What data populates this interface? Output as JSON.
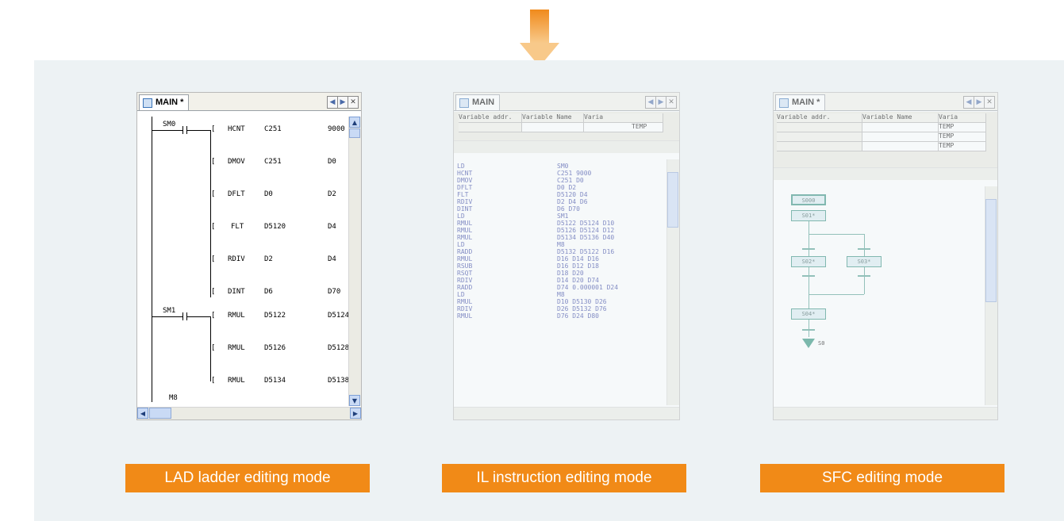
{
  "colors": {
    "accent": "#f18a17",
    "panel": "#edf2f4"
  },
  "captions": {
    "lad": "LAD ladder editing mode",
    "il": "IL instruction editing mode",
    "sfc": "SFC editing mode"
  },
  "lad": {
    "tab_title": "MAIN *",
    "icon": "ladder-doc-icon",
    "contacts": [
      "SM0",
      "SM1",
      "M8"
    ],
    "rungs": [
      {
        "op": "HCNT",
        "a": "C251",
        "b": "9000"
      },
      {
        "op": "DMOV",
        "a": "C251",
        "b": "D0"
      },
      {
        "op": "DFLT",
        "a": "D0",
        "b": "D2"
      },
      {
        "op": "FLT",
        "a": "D5120",
        "b": "D4"
      },
      {
        "op": "RDIV",
        "a": "D2",
        "b": "D4"
      },
      {
        "op": "DINT",
        "a": "D6",
        "b": "D70"
      },
      {
        "op": "RMUL",
        "a": "D5122",
        "b": "D5124"
      },
      {
        "op": "RMUL",
        "a": "D5126",
        "b": "D5128"
      },
      {
        "op": "RMUL",
        "a": "D5134",
        "b": "D5138"
      }
    ]
  },
  "il": {
    "tab_title": "MAIN",
    "headers": [
      "Variable addr.",
      "Variable Name",
      "Varia"
    ],
    "var_type": "TEMP",
    "rows": [
      {
        "op": "LD",
        "args": "SM0"
      },
      {
        "op": "HCNT",
        "args": "C251 9000"
      },
      {
        "op": "DMOV",
        "args": "C251 D0"
      },
      {
        "op": "DFLT",
        "args": "D0 D2"
      },
      {
        "op": "FLT",
        "args": "D5120 D4"
      },
      {
        "op": "RDIV",
        "args": "D2 D4 D6"
      },
      {
        "op": "DINT",
        "args": "D6 D70"
      },
      {
        "op": "LD",
        "args": "SM1"
      },
      {
        "op": "RMUL",
        "args": "D5122 D5124 D10"
      },
      {
        "op": "RMUL",
        "args": "D5126 D5124 D12"
      },
      {
        "op": "RMUL",
        "args": "D5134 D5136 D40"
      },
      {
        "op": "LD",
        "args": "M8"
      },
      {
        "op": "RADD",
        "args": "D5132 D5122 D16"
      },
      {
        "op": "RMUL",
        "args": "D16 D14 D16"
      },
      {
        "op": "RSUB",
        "args": "D16 D12 D18"
      },
      {
        "op": "RSQT",
        "args": "D18 D20"
      },
      {
        "op": "RDIV",
        "args": "D14 D20 D74"
      },
      {
        "op": "RADD",
        "args": "D74 0.000001 D24"
      },
      {
        "op": "LD",
        "args": "M8"
      },
      {
        "op": "RMUL",
        "args": "D10 D5130 D26"
      },
      {
        "op": "RDIV",
        "args": "D26 D5132 D76"
      },
      {
        "op": "RMUL",
        "args": "D76 D24 D80"
      }
    ]
  },
  "sfc": {
    "tab_title": "MAIN *",
    "headers": [
      "Variable addr.",
      "Variable Name",
      "Varia"
    ],
    "var_types": [
      "TEMP",
      "TEMP",
      "TEMP"
    ],
    "steps": [
      "S000",
      "S01*",
      "S02*",
      "S03*",
      "S04*"
    ],
    "end_label": "S0"
  }
}
